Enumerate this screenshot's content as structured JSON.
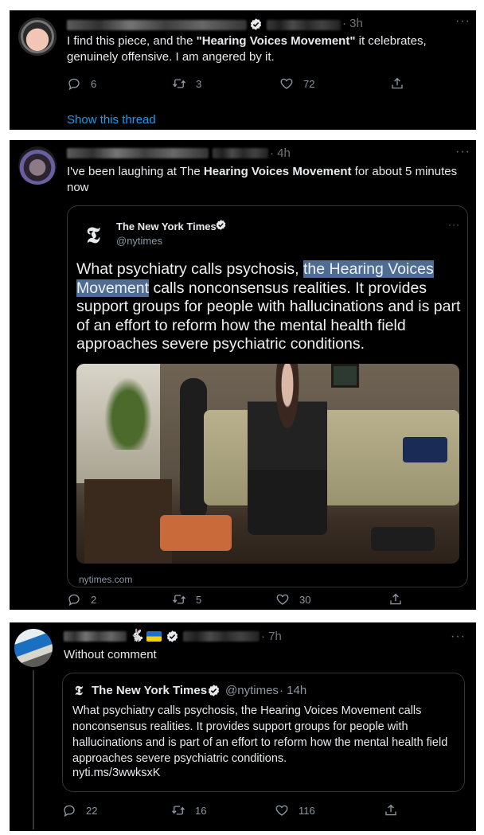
{
  "tweet1": {
    "time": "· 3h",
    "text_a": "I find this piece, and the ",
    "text_b": "\"Hearing Voices Movement\"",
    "text_c": " it celebrates, genuinely offensive. I am angered by it.",
    "replies": "6",
    "retweets": "3",
    "likes": "72",
    "show_thread": "Show this thread"
  },
  "tweet2": {
    "time": "· 4h",
    "text_a": "I've been laughing at The ",
    "text_b": "Hearing Voices Movement",
    "text_c": " for about 5 minutes now",
    "quoted": {
      "name": "The New York Times",
      "handle": "@nytimes",
      "text_a": "What psychiatry calls psychosis, ",
      "text_b": "the Hearing Voices Movement",
      "text_c": " calls nonconsensus realities. It provides support groups for people with hallucinations and is part of an effort to reform how the mental health field approaches severe psychiatric conditions.",
      "domain": "nytimes.com"
    },
    "replies": "2",
    "retweets": "5",
    "likes": "30"
  },
  "tweet3": {
    "time": "· 7h",
    "text": "Without comment",
    "quoted": {
      "name": "The New York Times",
      "handle": "@nytimes",
      "time": "· 14h",
      "text": "What psychiatry calls psychosis, the Hearing Voices Movement calls nonconsensus realities. It provides support groups for people with hallucinations and is part of an effort to reform how the mental health field approaches severe psychiatric conditions.",
      "link": "nyti.ms/3wwksxK"
    },
    "replies": "22",
    "retweets": "16",
    "likes": "116"
  },
  "icons": {
    "reply": "reply-icon",
    "retweet": "retweet-icon",
    "like": "heart-icon",
    "share": "share-icon",
    "more": "more-icon",
    "verified": "verified-badge-icon",
    "nyt": "nyt-logo"
  },
  "colors": {
    "background": "#000000",
    "text": "#e7e9ea",
    "muted": "#71767b",
    "link": "#1d9bf0",
    "highlight": "#4f6c93"
  }
}
